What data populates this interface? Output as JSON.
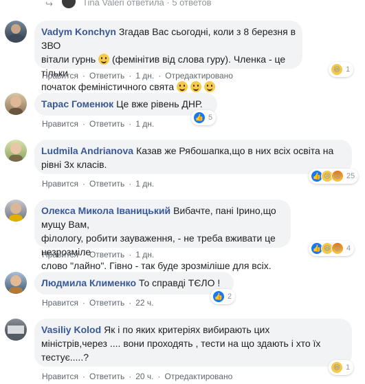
{
  "thread_header": {
    "text": "Tina Valeri ответила · 5 ответов"
  },
  "comments": [
    {
      "author": "Vadym Konchyn",
      "line1": "Згадав Вас сьогодні, коли з 8 березня в ЗВО",
      "line2_pre": "вітали гурнь",
      "line2_post": "(фемінітив від слова гуру). Членка - це тільки",
      "line3": "початок феміністичного свята",
      "like": "Нравится",
      "reply": "Ответить",
      "time": "1 дн.",
      "edited": "Отредактировано",
      "reaction_count": "1"
    },
    {
      "author": "Тарас Гоменюк",
      "line1": "Це вже рівень ДНР.",
      "like": "Нравится",
      "reply": "Ответить",
      "time": "1 дн.",
      "reaction_count": "5"
    },
    {
      "author": "Ludmila Andrianova",
      "line1": "Казав же Рябошапка,що в них всіх освіта на",
      "line2": "рівні 3х класів.",
      "like": "Нравится",
      "reply": "Ответить",
      "time": "1 дн.",
      "reaction_count": "25"
    },
    {
      "author": "Олекса Микола Іваницький",
      "line1": "Вибачте, пані Ірино,що мущу Вам,",
      "line2": "філологу, робити зауваження, - не треба вживати це незрозміле",
      "line3": "слово \"лайно\". Гівно - так буде зрозміліше для всіх.",
      "like": "Нравится",
      "reply": "Ответить",
      "time": "1 дн.",
      "reaction_count": "4"
    },
    {
      "author": "Людмила Клименко",
      "line1": "То справді ТЄЛО !",
      "like": "Нравится",
      "reply": "Ответить",
      "time": "22 ч.",
      "reaction_count": "2"
    },
    {
      "author": "Vasiliy Kolod",
      "line1": "Як і по яких критеріях вибирають цих",
      "line2": "міністрів,через .... вони проходять , тести на що здають і хто їх",
      "line3": "тестує.....?",
      "like": "Нравится",
      "reply": "Ответить",
      "time": "20 ч.",
      "edited": "Отредактировано",
      "reaction_count": "1"
    }
  ],
  "colors": {
    "author_link": "#385898",
    "bubble_bg": "#f2f3f5",
    "meta_text": "#606770",
    "like_blue": "#1877f2"
  }
}
